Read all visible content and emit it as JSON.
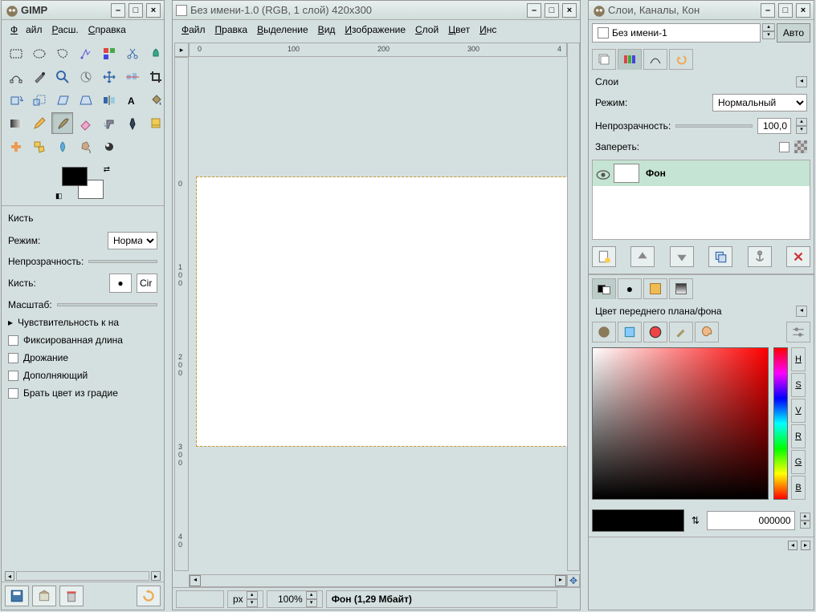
{
  "toolbox": {
    "title": "GIMP",
    "menu": {
      "file": "Файл",
      "ext": "Расш.",
      "help": "Справка"
    },
    "options_title": "Кисть",
    "mode_label": "Режим:",
    "mode_value": "Нормал",
    "opacity_label": "Непрозрачность:",
    "brush_label": "Кисть:",
    "brush_value": "Cir",
    "scale_label": "Масштаб:",
    "pressure_label": "Чувствительность к на",
    "fixed_label": "Фиксированная длина",
    "jitter_label": "Дрожание",
    "incremental_label": "Дополняющий",
    "gradient_label": "Брать цвет из градие"
  },
  "canvas": {
    "title": "Без имени-1.0 (RGB, 1 слой) 420x300",
    "menu": {
      "file": "Файл",
      "edit": "Правка",
      "select": "Выделение",
      "view": "Вид",
      "image": "Изображение",
      "layer": "Слой",
      "color": "Цвет",
      "tools": "Инс"
    },
    "ruler_marks_h": [
      "0",
      "100",
      "200",
      "300",
      "4"
    ],
    "ruler_marks_v": [
      "0",
      "1\n0\n0",
      "2\n0\n0",
      "3\n0\n0",
      "4\n0"
    ],
    "unit": "px",
    "zoom": "100%",
    "status": "Фон (1,29 Мбайт)"
  },
  "layers": {
    "title": "Слои, Каналы, Кон",
    "image_name": "Без имени-1",
    "auto": "Авто",
    "panel_title": "Слои",
    "mode_label": "Режим:",
    "mode_value": "Нормальный",
    "opacity_label": "Непрозрачность:",
    "opacity_value": "100,0",
    "lock_label": "Запереть:",
    "layer_items": [
      {
        "name": "Фон"
      }
    ],
    "fgbg_title": "Цвет переднего плана/фона",
    "mode_btns": [
      "H",
      "S",
      "V",
      "R",
      "G",
      "B"
    ],
    "hex": "000000"
  }
}
